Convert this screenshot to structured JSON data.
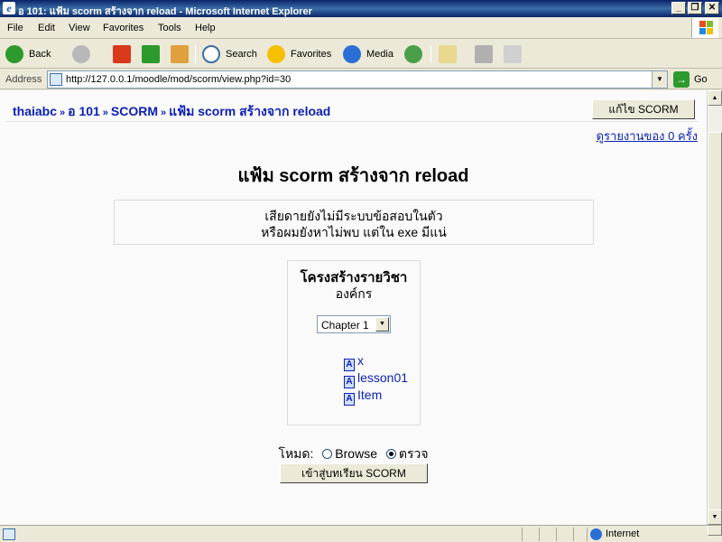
{
  "window": {
    "title": "อ 101: แฟ้ม scorm สร้างจาก reload - Microsoft Internet Explorer",
    "minimize": "_",
    "restore": "❐",
    "close": "✕"
  },
  "menu": [
    "File",
    "Edit",
    "View",
    "Favorites",
    "Tools",
    "Help"
  ],
  "toolbar": {
    "back": "Back",
    "search": "Search",
    "favorites": "Favorites",
    "media": "Media"
  },
  "address": {
    "label": "Address",
    "url": "http://127.0.0.1/moodle/mod/scorm/view.php?id=30",
    "go": "Go"
  },
  "page": {
    "breadcrumb": [
      "thaiabc",
      "อ 101",
      "SCORM",
      "แฟ้ม scorm สร้างจาก reload"
    ],
    "breadcrumb_sep": "»",
    "edit_button": "แก้ไข SCORM",
    "report_link": "ดูรายงานของ 0 ครั้ง",
    "title": "แฟ้ม scorm สร้างจาก reload",
    "notice_line1": "เสียดายยังไม่มีระบบข้อสอบในตัว",
    "notice_line2": "หรือผมยังหาไม่พบ แต่ใน exe มีแน่",
    "structure_heading": "โครงสร้างรายวิชา",
    "organization": "องค์กร",
    "chapter_select": "Chapter 1",
    "items": [
      "x",
      "lesson01",
      "Item"
    ],
    "mode_label": "โหมด:",
    "mode_browse": "Browse",
    "mode_review": "ตรวจ",
    "enter_button": "เข้าสู่บทเรียน SCORM"
  },
  "status": {
    "zone": "Internet"
  }
}
